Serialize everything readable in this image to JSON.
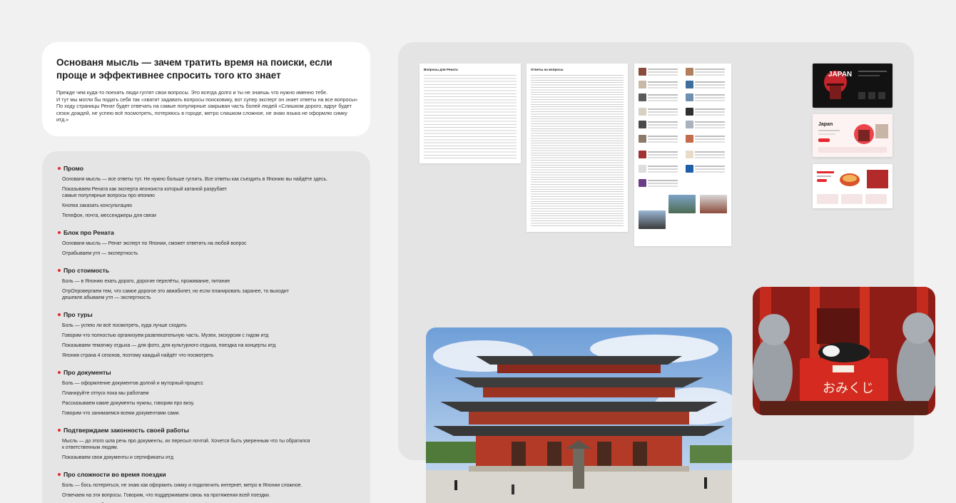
{
  "intro": {
    "title": "Основаня мысль — зачем тратить время на поиски, если проще и эффективнее спросить того кто знает",
    "text": "Прежде чем куда-то поехать люди гуглят свои вопросы. Это всегда долго и ты не знаешь что нужно именно тебе.\nИ тут мы могли бы подать себя так «хватит задавать вопросы поисковику, вот супер эксперт он знает ответы на все вопросы»\nПо ходу страницы Ренат будет отвечать на самые популярные закрывая часть болей людей «Слишком дорого, вдруг будет сезон дождей, не успею всё посмотреть, потеряюсь в городе, метро слишком сложное, не знаю языка не оформлю симку итд.»"
  },
  "sections": [
    {
      "title": "Промо",
      "items": [
        "Основаня мысль — все ответы тут. Не нужно больше гуглить. Все ответы как съездить в Японию вы найдёте здесь.",
        "Показываем Рената как эксперта японоиста который катаной разрубает\nсамые популярные вопросы про японию",
        "Кнопка заказать консультацию",
        "Телефон, почта, мессенджеры для связи"
      ]
    },
    {
      "title": "Блок про Рената",
      "items": [
        "Основаня мысль — Ренат эксперт по Японии, сможет ответить на любой вопрос",
        "Отрабываем утп — экспертность"
      ]
    },
    {
      "title": "Про стоимость",
      "items": [
        "Боль — в Японию ехать дорого, дорогие перелёты, проживание, питание",
        "ОтрОпровергаем тем, что самое дорогое это авиабилет, но если планировать заранее, то выходит\nдешевле.абываем утп — экспертность"
      ]
    },
    {
      "title": "Про туры",
      "items": [
        "Боль — успею ли всё посмотреть, куда лучше сходить",
        "Говорим что полностью организуем развлекательную часть. Музеи, экскурсии с гидом итд",
        "Показываем тематику отдыха — для фото, для культурного отдыха, поездка на концерты итд",
        "Япония страна 4 сезонов, поэтому каждый найдёт что посмотреть"
      ]
    },
    {
      "title": "Про документы",
      "items": [
        "Боль — оформление документов долгий и муторный процесс",
        "Планируйте отпуск пока мы работаем",
        "Рассказываем какие документы нужны, говорим про визу.",
        "Говорим что занимаемся всеми документами сами."
      ]
    },
    {
      "title": "Подтверждаем законность своей работы",
      "items": [
        "Мысль — до этого шла речь про документы, их пересыл почтой. Хочется быть уверенным что ты обратился\nк ответственным людям.",
        "Показываем свои документы и сертификаты итд"
      ]
    },
    {
      "title": "Про сложности во время поездки",
      "items": [
        "Боль — бось потеряться, не знаю как оформить симку и подключить интернет, метро в Японии сложное.",
        "Отвечаем на эти вопросы. Говорим, что поддерживаем связь на протяжении всей поездки.",
        "Япония дружелюбная страна и путешествовать тут очень комфортно."
      ]
    }
  ],
  "docs": {
    "questions_title": "Вопросы для Рената",
    "answers_title": "Ответы на вопросы"
  },
  "thumbs": {
    "site1_logo": "JAPAN",
    "site2_logo": "Japan",
    "cats_sign": "おみくじ"
  },
  "colors": {
    "accent": "#e8262d",
    "gallery_bg": "#e4e4e4",
    "card_bg": "#ffffff"
  }
}
